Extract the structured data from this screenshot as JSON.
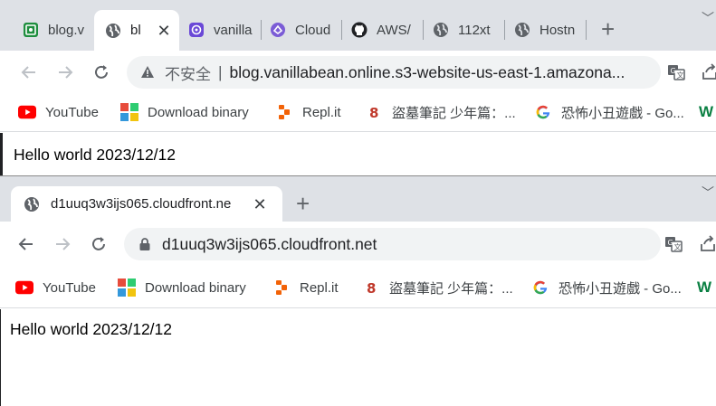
{
  "window1": {
    "tabs": [
      {
        "title": "blog.v",
        "icon": "green-page-icon"
      },
      {
        "title": "bl",
        "icon": "globe-icon",
        "active": true
      },
      {
        "title": "vanilla",
        "icon": "purple-app-icon"
      },
      {
        "title": "Cloud",
        "icon": "purple-cloud-icon"
      },
      {
        "title": "AWS/",
        "icon": "github-icon"
      },
      {
        "title": "112xt",
        "icon": "globe-icon"
      },
      {
        "title": "Hostn",
        "icon": "globe-icon"
      }
    ],
    "address": {
      "security": "不安全",
      "separator": "|",
      "url": "blog.vanillabean.online.s3-website-us-east-1.amazona..."
    },
    "content_text": "Hello world 2023/12/12"
  },
  "window2": {
    "tab_title": "d1uuq3w3ijs065.cloudfront.ne",
    "address": {
      "url": "d1uuq3w3ijs065.cloudfront.net"
    },
    "content_text": "Hello world 2023/12/12"
  },
  "bookmarks": [
    {
      "label": "YouTube",
      "icon": "youtube-icon"
    },
    {
      "label": "Download binary",
      "icon": "colored-squares-icon"
    },
    {
      "label": "Repl.it",
      "icon": "replit-icon"
    },
    {
      "label": "盜墓筆記 少年篇：...",
      "icon": "eight-icon"
    },
    {
      "label": "恐怖小丑遊戲 - Go...",
      "icon": "google-icon"
    },
    {
      "label": "W",
      "icon": "w-icon"
    }
  ],
  "colors": {
    "tabstrip": "#dee1e6",
    "omnibox": "#f1f3f4",
    "youtube_red": "#ff0000",
    "replit_orange": "#f26207",
    "purple": "#6a48d7"
  }
}
